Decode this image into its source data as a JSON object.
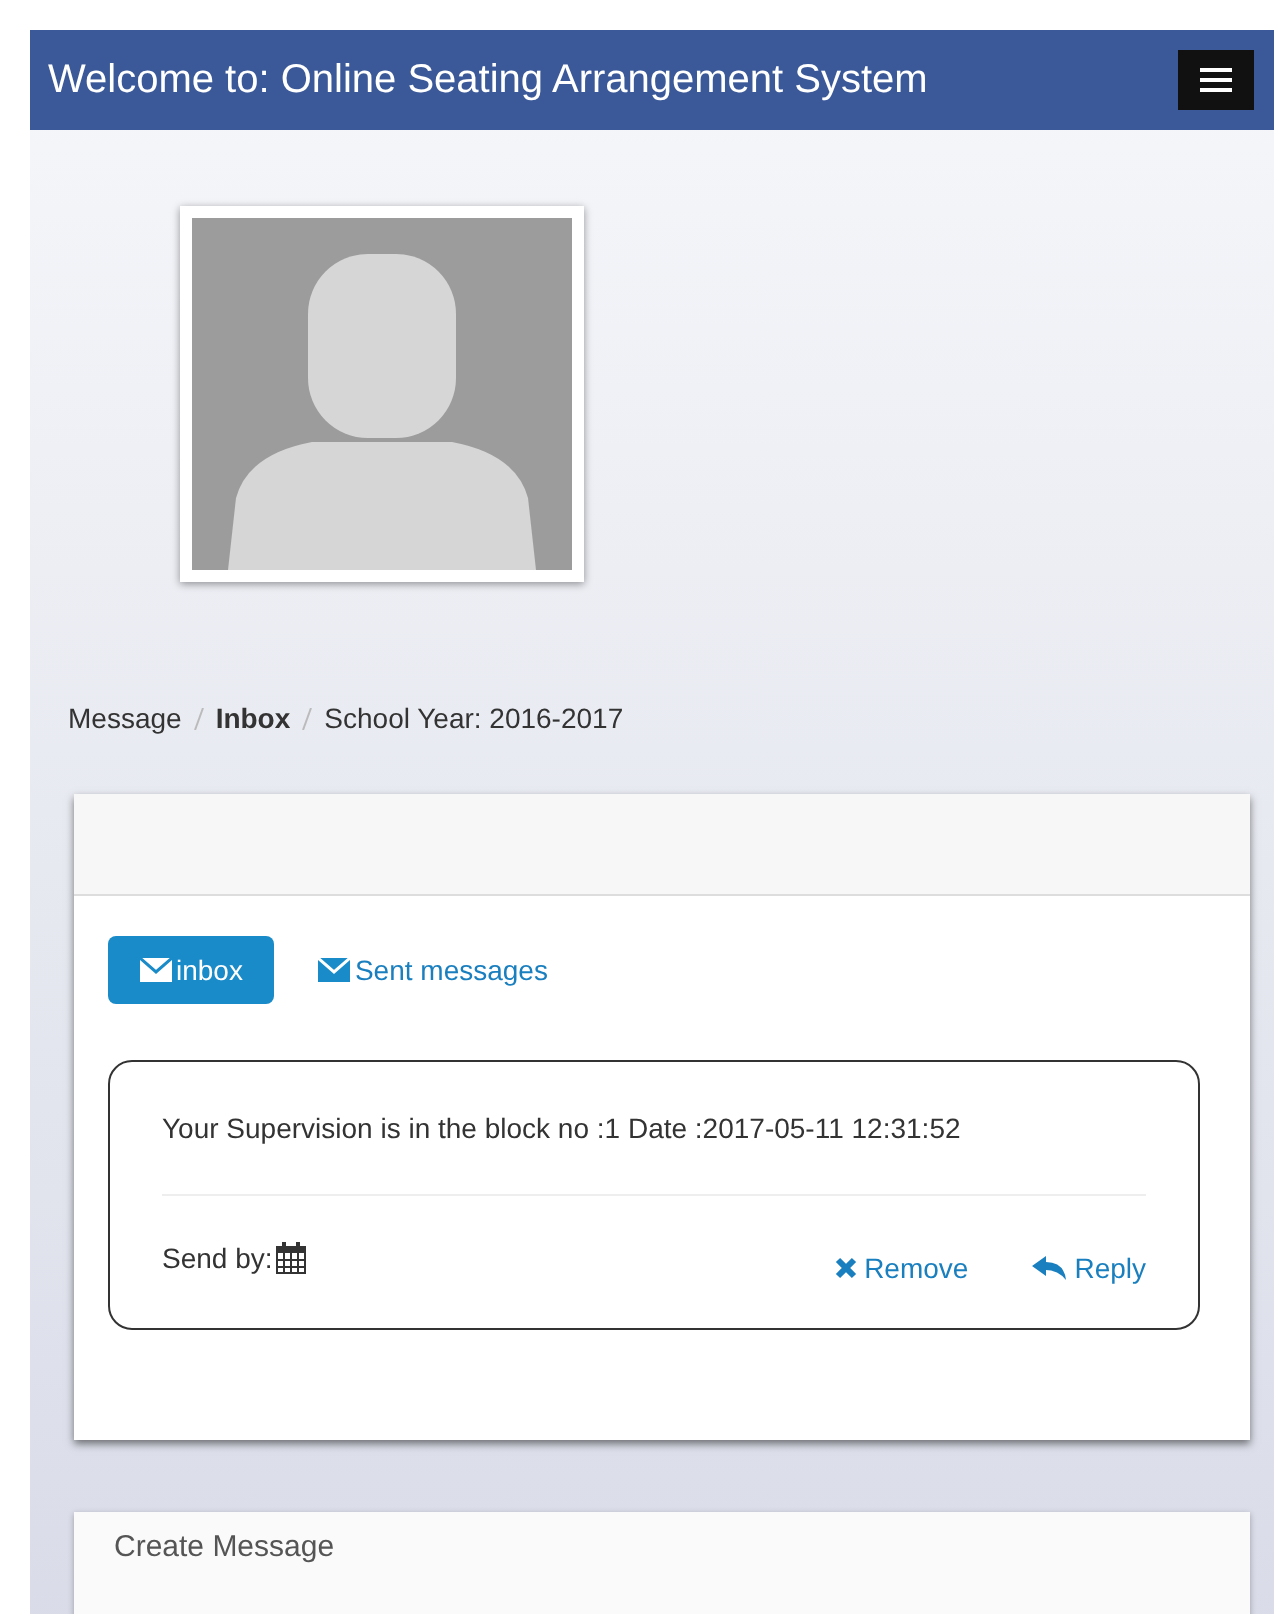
{
  "header": {
    "title": "Welcome to: Online Seating Arrangement System"
  },
  "breadcrumb": [
    {
      "label": "Message",
      "selected": false
    },
    {
      "label": "Inbox",
      "selected": true
    },
    {
      "label": "School Year: 2016-2017",
      "selected": false
    }
  ],
  "tabs": [
    {
      "label": "inbox",
      "selected": true
    },
    {
      "label": "Sent messages",
      "selected": false
    }
  ],
  "messages": [
    {
      "text": "Your Supervision is in the block no :1 Date :2017-05-11 12:31:52",
      "sender_label": "Send by:",
      "remove": "Remove",
      "reply": "Reply"
    }
  ],
  "create_card": {
    "title": "Create Message"
  }
}
